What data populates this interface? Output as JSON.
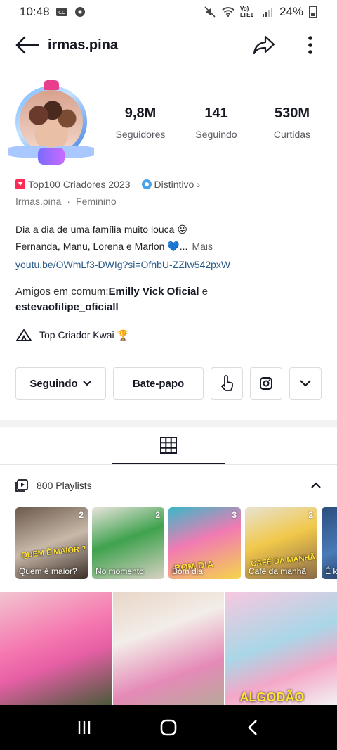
{
  "status_bar": {
    "time": "10:48",
    "network": "Vo) LTE1",
    "battery": "24%"
  },
  "header": {
    "title": "irmas.pina"
  },
  "stats": [
    {
      "value": "9,8M",
      "label": "Seguidores"
    },
    {
      "value": "141",
      "label": "Seguindo"
    },
    {
      "value": "530M",
      "label": "Curtidas"
    }
  ],
  "profile": {
    "rank": "Top100 Criadores 2023",
    "badge": "Distintivo",
    "badge_chevron": "›",
    "name": "Irmas.pina",
    "separator": "·",
    "gender": "Feminino",
    "bio_line1": "Dia a dia de uma família muito louca 😜",
    "bio_line2": "Fernanda, Manu, Lorena e Marlon 💙...",
    "bio_more": "Mais",
    "link": "youtu.be/OWmLf3-DWIg?si=OfnbU-ZZIw542pxW",
    "friends_prefix": "Amigos em comum:",
    "friend1": "Emilly Vick Oficial",
    "friends_and": " e ",
    "friend2": "estevaofilipe_oficiall",
    "top_criador": "Top Criador Kwai 🏆"
  },
  "actions": {
    "following": "Seguindo",
    "chat": "Bate-papo"
  },
  "playlists": {
    "header": "800 Playlists",
    "items": [
      {
        "count": "2",
        "title": "Quem é maior?",
        "caption": "QUEM É MAIOR ?",
        "bg": "linear-gradient(160deg,#6b5a4d,#c8b8a8 50%,#3a2e28)"
      },
      {
        "count": "2",
        "title": "No momento",
        "caption": "",
        "bg": "linear-gradient(160deg,#e9e4dc,#3fa24e 45%,#d9d1c4)"
      },
      {
        "count": "3",
        "title": "Bom dia",
        "caption": "BOM DIA",
        "bg": "linear-gradient(160deg,#39b8c8,#f27ab3 45%,#f4d54a)"
      },
      {
        "count": "2",
        "title": "Café da manhã",
        "caption": "CAFÉ DA MANHÃ",
        "bg": "linear-gradient(160deg,#e8e2d2,#f1c84a 45%,#8a6a4a)"
      },
      {
        "count": "2",
        "title": "É k",
        "caption": "",
        "bg": "linear-gradient(160deg,#2b4f7e,#4a7ab8 50%,#1a2a44)"
      }
    ]
  },
  "videos": [
    {
      "bg": "linear-gradient(160deg,#f2c4d0,#f57ab0 40%,#e75fa6 60%,#4a5a3a)",
      "caption": ""
    },
    {
      "bg": "linear-gradient(160deg,#e8d6c8,#f3ede8 35%,#e58ab7 70%,#b8a89a)",
      "caption": ""
    },
    {
      "bg": "linear-gradient(160deg,#f7c8e0,#a9d7e7 45%,#f4a7c8 70%,#f2f2f2)",
      "caption": "ALGODÃO"
    }
  ],
  "colors": {
    "accent": "#fe2c55",
    "link": "#2b5a8a"
  }
}
